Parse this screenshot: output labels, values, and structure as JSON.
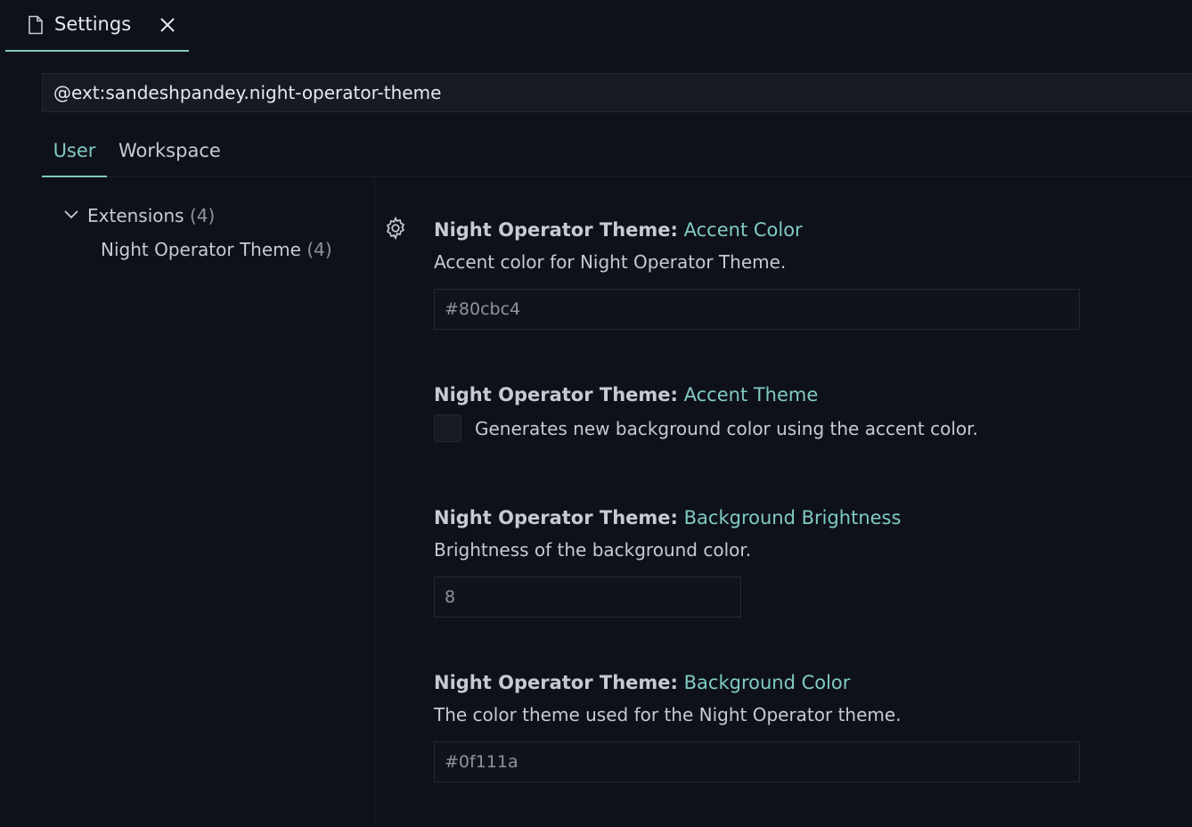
{
  "tab": {
    "label": "Settings",
    "icon": "file-icon",
    "close_icon": "close-icon"
  },
  "search": {
    "value": "@ext:sandeshpandey.night-operator-theme"
  },
  "scope_tabs": {
    "user": "User",
    "workspace": "Workspace"
  },
  "toc": {
    "extensions": {
      "label": "Extensions",
      "count": "(4)"
    },
    "night_operator": {
      "label": "Night Operator Theme",
      "count": "(4)"
    }
  },
  "settings": [
    {
      "category": "Night Operator Theme:",
      "name": "Accent Color",
      "description": "Accent color for Night Operator Theme.",
      "value": "#80cbc4"
    },
    {
      "category": "Night Operator Theme:",
      "name": "Accent Theme",
      "description": "Generates new background color using the accent color.",
      "checked": false
    },
    {
      "category": "Night Operator Theme:",
      "name": "Background Brightness",
      "description": "Brightness of the background color.",
      "value": "8"
    },
    {
      "category": "Night Operator Theme:",
      "name": "Background Color",
      "description": "The color theme used for the Night Operator theme.",
      "value": "#0f111a"
    }
  ],
  "colors": {
    "accent": "#80cbc4",
    "background": "#0f111a"
  }
}
